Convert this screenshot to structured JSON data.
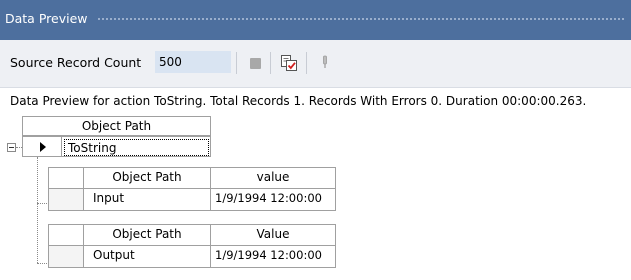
{
  "window": {
    "title": "Data Preview"
  },
  "toolbar": {
    "source_count_label": "Source Record Count",
    "source_count_value": "500",
    "stop_icon": "stop-icon",
    "preview_icon": "preview-check-icon",
    "pin_icon": "pin-icon"
  },
  "status": {
    "message": "Data Preview for action ToString. Total Records 1. Records With Errors 0. Duration 00:00:00.263."
  },
  "grid": {
    "header": "Object Path",
    "root_row": {
      "value": "ToString"
    },
    "children": [
      {
        "col1_header": "Object Path",
        "col2_header": "value",
        "row": {
          "path": "Input",
          "value": "1/9/1994 12:00:00"
        }
      },
      {
        "col1_header": "Object Path",
        "col2_header": "Value",
        "row": {
          "path": "Output",
          "value": "1/9/1994 12:00:00"
        }
      }
    ]
  },
  "colors": {
    "titlebar": "#4d6f9e",
    "toolbar": "#eef0f4",
    "input_bg": "#d9e4f2"
  }
}
